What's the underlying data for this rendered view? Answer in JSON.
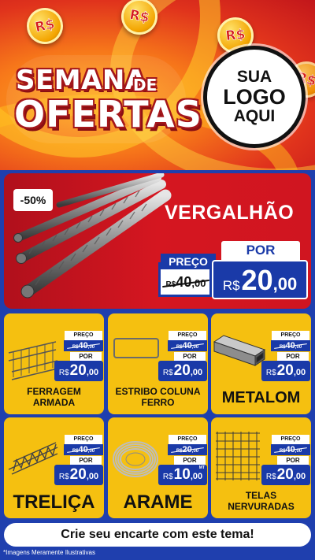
{
  "header": {
    "coin_symbol": "R$",
    "title_line1": "SEMANA",
    "title_de": "DE",
    "title_line2": "OFERTAS",
    "logo_line1": "SUA",
    "logo_line2": "LOGO",
    "logo_line3": "AQUI"
  },
  "hero": {
    "discount": "-50%",
    "product": "VERGALHÃO",
    "preco_label": "PREÇO",
    "old_currency": "R$",
    "old_int": "40",
    "old_dec": ",00",
    "por_label": "POR",
    "new_currency": "R$",
    "new_int": "20",
    "new_dec": ",00"
  },
  "cards": [
    {
      "name": "FERRAGEM ARMADA",
      "preco_label": "PREÇO",
      "old_currency": "R$",
      "old_int": "40",
      "old_dec": ",00",
      "por_label": "POR",
      "new_currency": "R$",
      "new_int": "20",
      "new_dec": ",00",
      "icon": "rebar-cage-icon"
    },
    {
      "name": "ESTRIBO COLUNA FERRO",
      "preco_label": "PREÇO",
      "old_currency": "R$",
      "old_int": "40",
      "old_dec": ",00",
      "por_label": "POR",
      "new_currency": "R$",
      "new_int": "20",
      "new_dec": ",00",
      "icon": "stirrup-icon"
    },
    {
      "name": "METALOM",
      "preco_label": "PREÇO",
      "old_currency": "R$",
      "old_int": "40",
      "old_dec": ",00",
      "por_label": "POR",
      "new_currency": "R$",
      "new_int": "20",
      "new_dec": ",00",
      "icon": "metal-tube-icon"
    },
    {
      "name": "TRELIÇA",
      "preco_label": "PREÇO",
      "old_currency": "R$",
      "old_int": "40",
      "old_dec": ",00",
      "por_label": "POR",
      "new_currency": "R$",
      "new_int": "20",
      "new_dec": ",00",
      "icon": "truss-icon"
    },
    {
      "name": "ARAME",
      "preco_label": "PREÇO",
      "old_currency": "R$",
      "old_int": "20",
      "old_dec": ",00",
      "por_label": "POR",
      "new_currency": "R$",
      "new_int": "10",
      "new_dec": ",00",
      "unit": "MT",
      "icon": "wire-coil-icon"
    },
    {
      "name": "TELAS NERVURADAS",
      "preco_label": "PREÇO",
      "old_currency": "R$",
      "old_int": "40",
      "old_dec": ",00",
      "por_label": "POR",
      "new_currency": "R$",
      "new_int": "20",
      "new_dec": ",00",
      "icon": "mesh-icon"
    }
  ],
  "footer": {
    "cta": "Crie seu encarte com este tema!",
    "disclaimer": "*Imagens Meramente Ilustrativas"
  },
  "colors": {
    "blue": "#1a3aa8",
    "red": "#d51620",
    "yellow": "#f5c010",
    "orange": "#f7781a"
  }
}
